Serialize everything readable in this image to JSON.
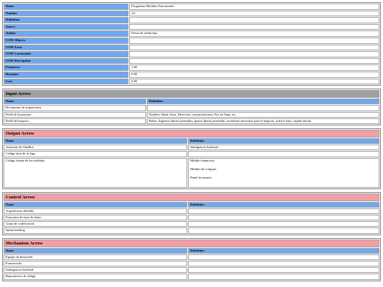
{
  "properties": [
    {
      "key": "Name",
      "value": "Programas Modulos Funcionales"
    },
    {
      "key": "Number",
      "value": "A2"
    },
    {
      "key": "Definition",
      "value": ""
    },
    {
      "key": "Source",
      "value": ""
    },
    {
      "key": "Author",
      "value": "Fiesta de salchichas"
    },
    {
      "key": "UOW Objects",
      "value": ""
    },
    {
      "key": "UOW Facts",
      "value": ""
    },
    {
      "key": "UOW Constraints",
      "value": ""
    },
    {
      "key": "UOW Description",
      "value": ""
    },
    {
      "key": "Frequency",
      "value": "1.00"
    },
    {
      "key": "Duration",
      "value": "0.00"
    },
    {
      "key": "Cost",
      "value": "0.00"
    }
  ],
  "input_arrow": {
    "title": "Input Arrow",
    "col_name": "Name",
    "col_def": "Definition",
    "rows": [
      {
        "name": "Documento de arquitectura",
        "definition": ""
      },
      {
        "name": "Perfil de la persona",
        "definition": "Nombre, Edad, Sexo, Direccion, cuenta bancaria, Nro de Yape, etc."
      },
      {
        "name": "Perfil del negocio",
        "definition": "Rubro, Ingresos diarios promedio, gastos diarias promedio, inventario necesario para el negocio, activos fijos, capital inicial."
      }
    ]
  },
  "output_arrow": {
    "title": "Output Arrow",
    "col_name": "Name",
    "col_def": "Definition",
    "rows": [
      {
        "name": "Asistente de ChatBot",
        "definition": "Inteligencia Artificial"
      },
      {
        "name": "Código base de la App",
        "definition": ""
      }
    ],
    "modules_row": {
      "name": "Código fuente de los módulos",
      "lines": [
        "Módulo financiero",
        "Módulo de compras",
        "Panel de usuario"
      ]
    }
  },
  "control_arrow": {
    "title": "Control Arrow",
    "col_name": "Name",
    "col_def": "Definition",
    "rows": [
      {
        "name": "Arquitectura definida",
        "definition": ""
      },
      {
        "name": "Estructura de base de datos",
        "definition": ""
      },
      {
        "name": "Guias de codificación",
        "definition": ""
      },
      {
        "name": "Sprint backlog",
        "definition": ""
      }
    ]
  },
  "mechanism_arrow": {
    "title": "Mechanism Arrow",
    "col_name": "Name",
    "col_def": "Definition",
    "rows": [
      {
        "name": "Equipo de desarrollo",
        "definition": ""
      },
      {
        "name": "Frameworks",
        "definition": ""
      },
      {
        "name": "Inteligencia Artificial",
        "definition": ""
      },
      {
        "name": "Repositorios de código",
        "definition": ""
      }
    ]
  }
}
